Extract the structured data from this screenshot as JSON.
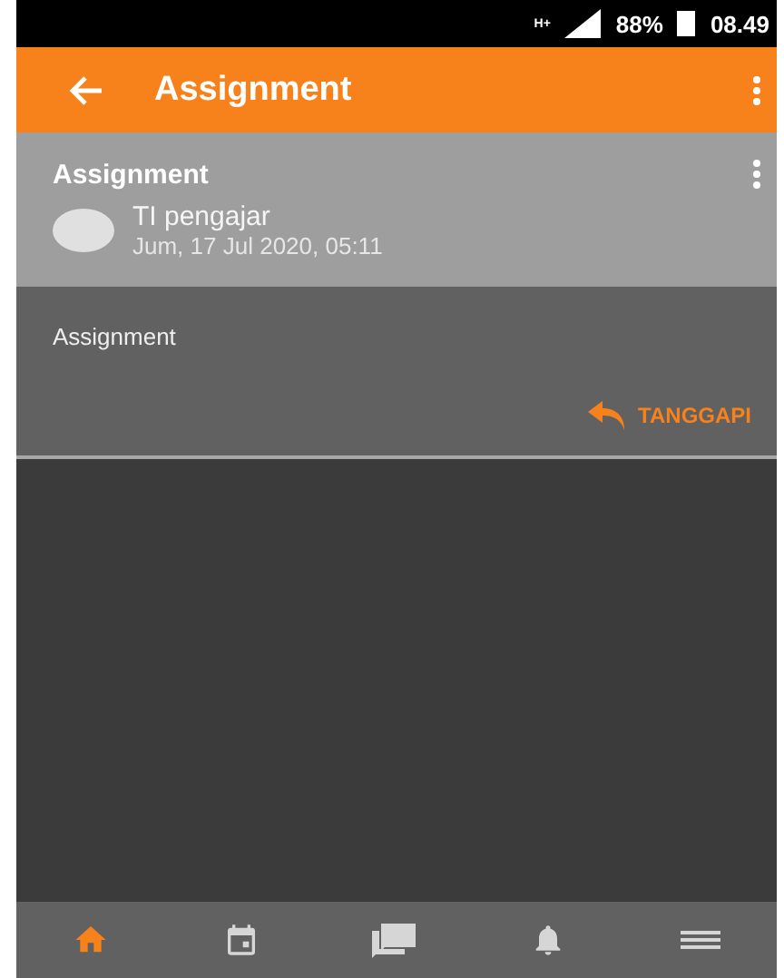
{
  "status_bar": {
    "network": "H+",
    "battery": "88%",
    "time": "08.49"
  },
  "app_bar": {
    "title": "Assignment"
  },
  "post": {
    "title": "Assignment",
    "author": "TI pengajar",
    "date": "Jum, 17 Jul 2020, 05:11",
    "body": "Assignment",
    "reply": "TANGGAPI"
  },
  "bottom_nav": [
    {
      "kind": "home",
      "selected": true
    },
    {
      "kind": "calendar",
      "selected": false
    },
    {
      "kind": "chat",
      "selected": false
    },
    {
      "kind": "bell",
      "selected": false
    },
    {
      "kind": "menu",
      "selected": false
    }
  ]
}
